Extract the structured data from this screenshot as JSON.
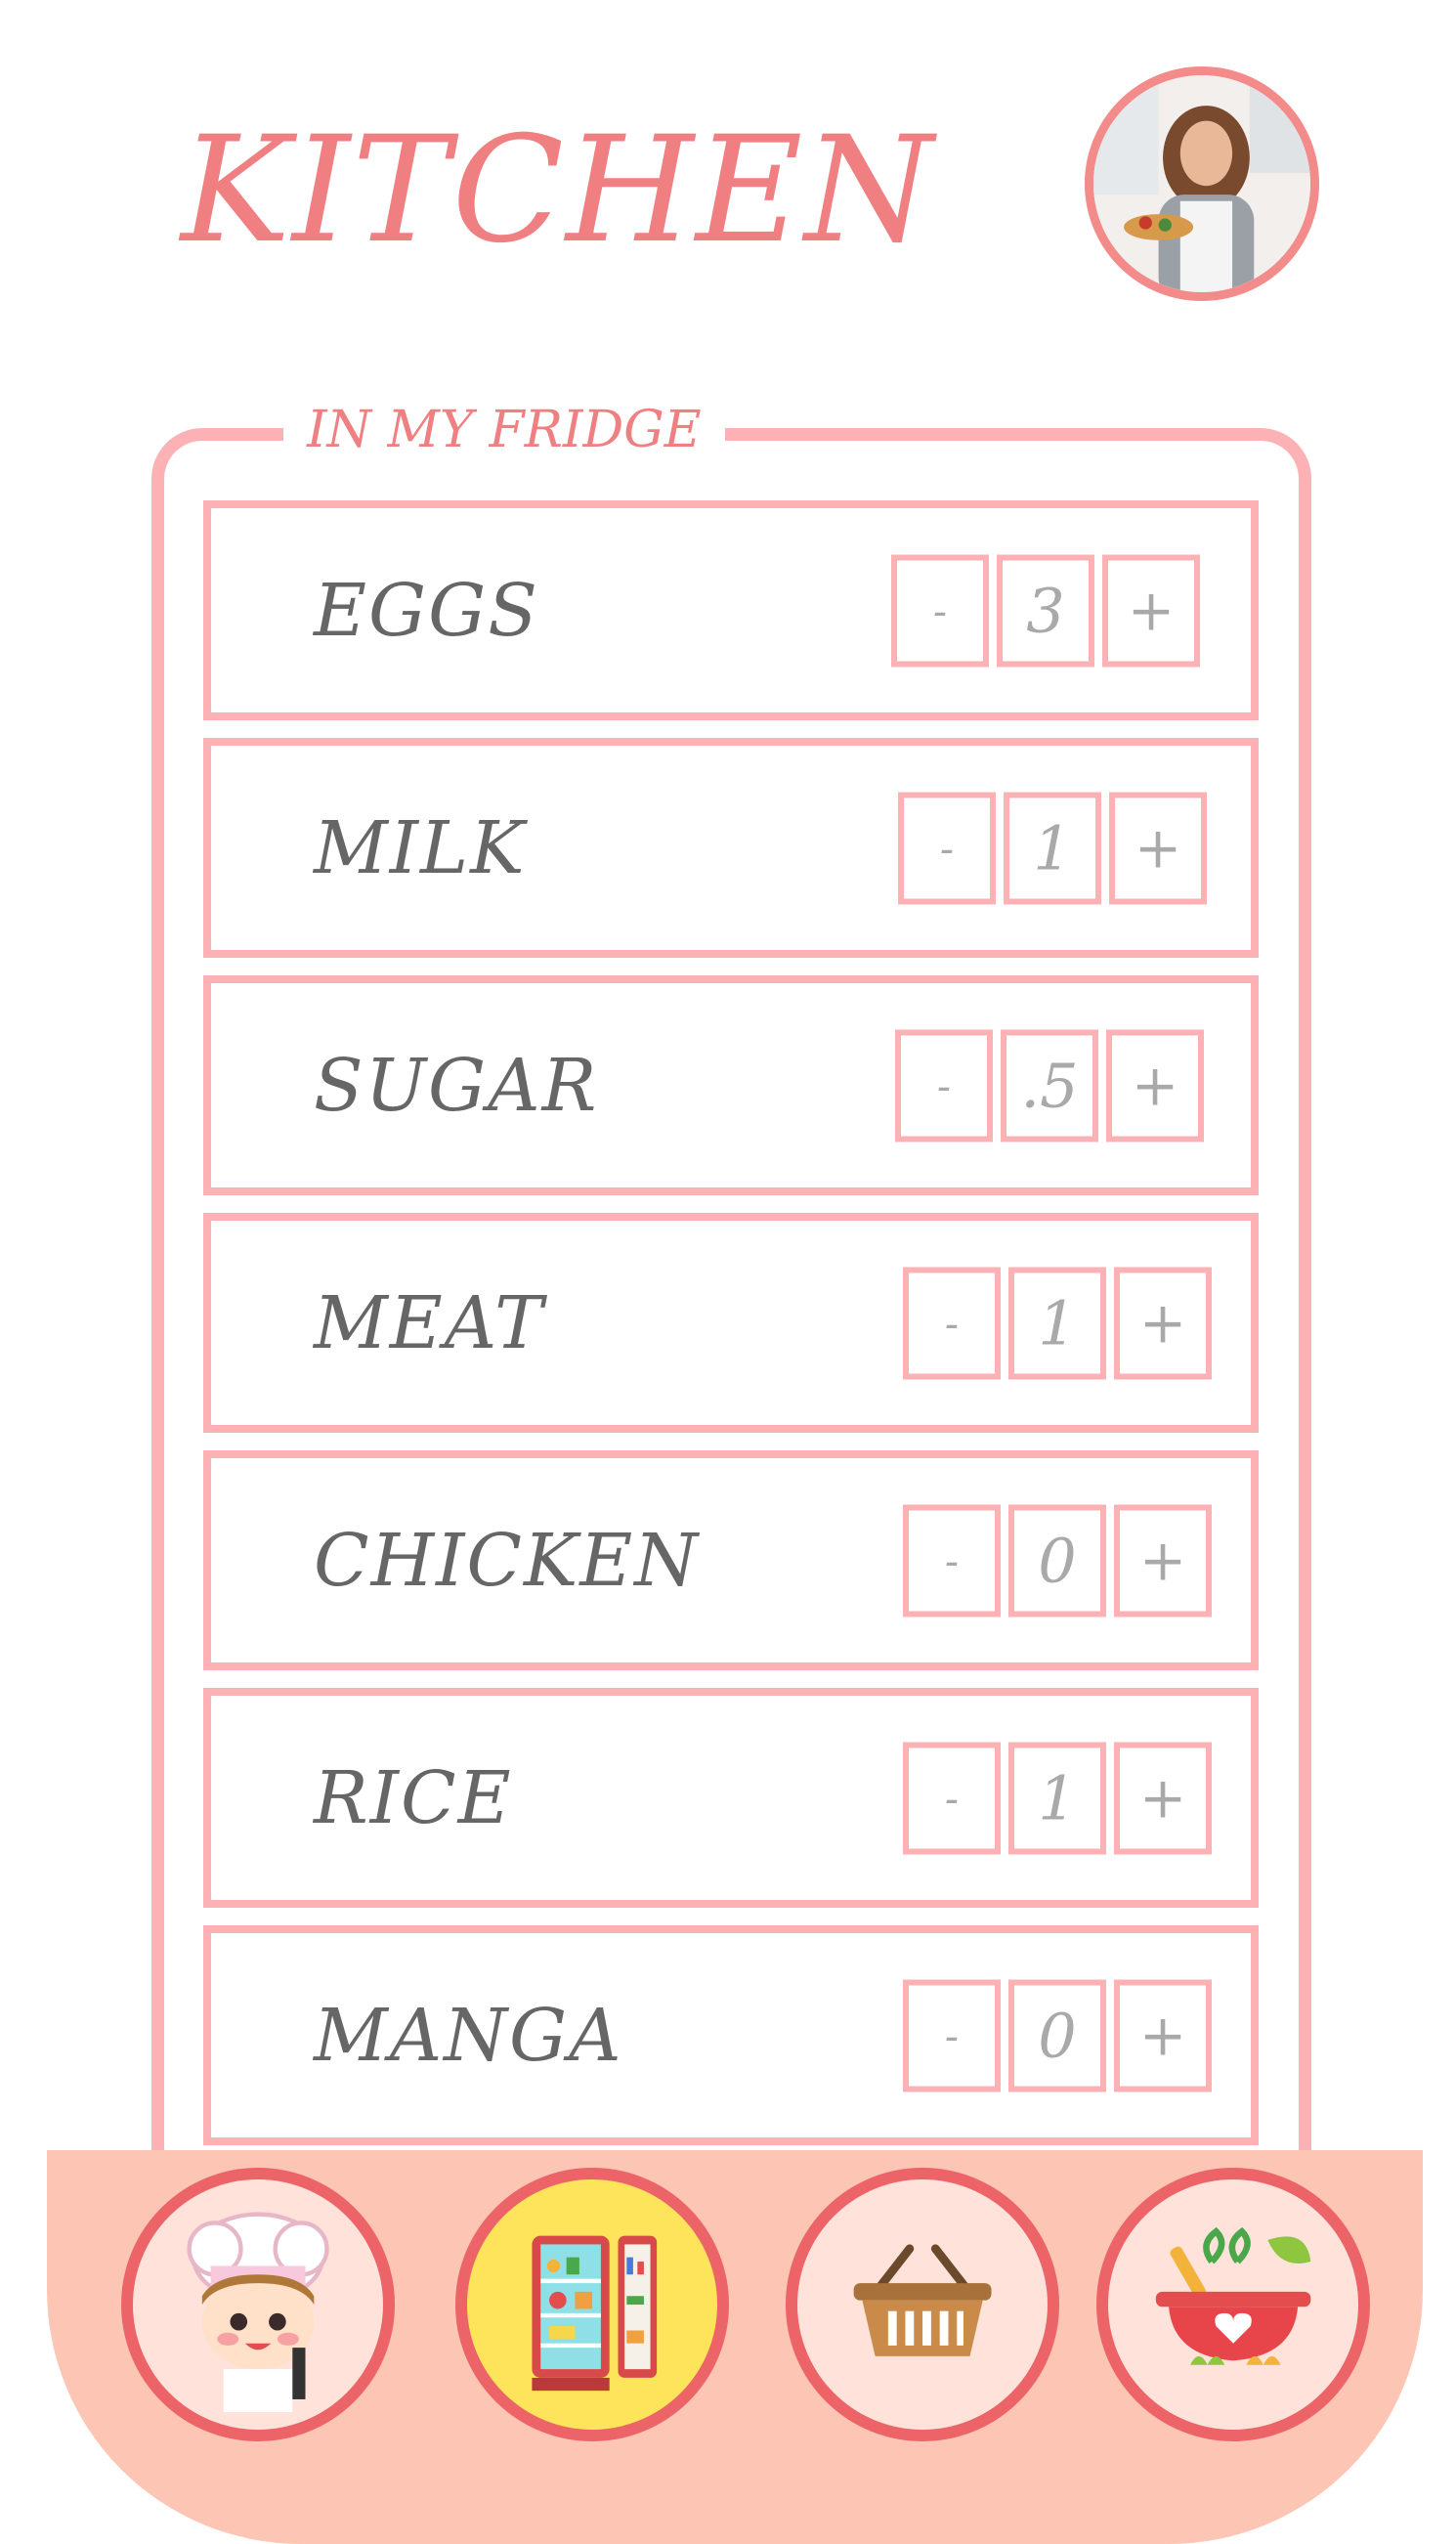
{
  "header": {
    "title": "KITCHEN"
  },
  "fridge": {
    "legend": "IN MY FRIDGE",
    "items": [
      {
        "name": "EGGS",
        "qty": "3",
        "minus": "-",
        "plus": "+"
      },
      {
        "name": "MILK",
        "qty": "1",
        "minus": "-",
        "plus": "+"
      },
      {
        "name": "SUGAR",
        "qty": ".5",
        "minus": "-",
        "plus": "+"
      },
      {
        "name": "MEAT",
        "qty": "1",
        "minus": "-",
        "plus": "+"
      },
      {
        "name": "CHICKEN",
        "qty": "0",
        "minus": "-",
        "plus": "+"
      },
      {
        "name": "RICE",
        "qty": "1",
        "minus": "-",
        "plus": "+"
      },
      {
        "name": "MANGA",
        "qty": "0",
        "minus": "-",
        "plus": "+"
      }
    ]
  },
  "nav": {
    "items": [
      {
        "icon": "chef-icon",
        "active": false
      },
      {
        "icon": "fridge-icon",
        "active": true
      },
      {
        "icon": "basket-icon",
        "active": false
      },
      {
        "icon": "cooking-pot-icon",
        "active": false
      }
    ]
  },
  "colors": {
    "accent": "#f07f82",
    "border": "#fcb2b4",
    "bottom_bar": "#fdc6b4",
    "nav_ring": "#ec6468",
    "active_nav": "#fde45a",
    "text": "#666666"
  }
}
